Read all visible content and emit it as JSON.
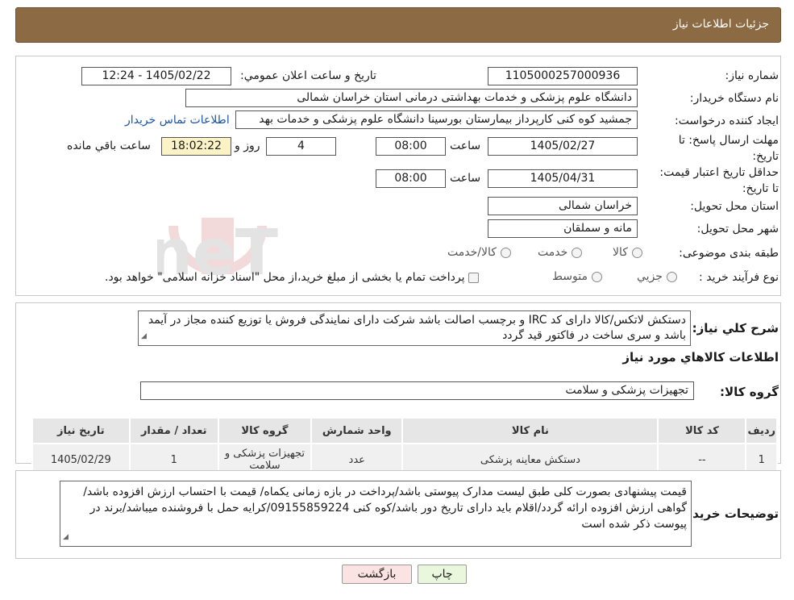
{
  "header": {
    "title": "جزئیات اطلاعات نیاز"
  },
  "form": {
    "need_number_label": "شماره نیاز:",
    "need_number": "1105000257000936",
    "announce_label": "تاریخ و ساعت اعلان عمومي:",
    "announce_value": "1405/02/22 - 12:24",
    "buyer_org_label": "نام دستگاه خريدار:",
    "buyer_org": "دانشگاه علوم پزشکی و خدمات بهداشتی درمانی استان خراسان شمالی",
    "creator_label": "ايجاد کننده درخواست:",
    "creator": "جمشید کوه کنی کارپرداز بیمارستان بورسینا دانشگاه علوم پزشکی و خدمات بهد",
    "contact_link": "اطلاعات تماس خريدار",
    "deadline_label": "مهلت ارسال پاسخ: تا تاريخ:",
    "deadline_date": "1405/02/27",
    "time_label": "ساعت",
    "deadline_time": "08:00",
    "days_value": "4",
    "days_label": "روز و",
    "remaining_time": "18:02:22",
    "remaining_label": "ساعت باقي مانده",
    "validity_label": "حداقل تاريخ اعتبار قيمت: تا تاريخ:",
    "validity_date": "1405/04/31",
    "validity_time": "08:00",
    "province_label": "استان محل تحويل:",
    "province": "خراسان شمالی",
    "city_label": "شهر محل تحويل:",
    "city": "مانه و سملقان",
    "category_label": "طبقه بندی موضوعی:",
    "category_options": [
      "کالا",
      "خدمت",
      "کالا/خدمت"
    ],
    "process_label": "نوع فرآيند خريد :",
    "process_options": [
      "جزيي",
      "متوسط"
    ],
    "process_note": "پرداخت تمام يا بخشی از مبلغ خريد،از محل \"اسناد خزانه اسلامی\" خواهد بود."
  },
  "description": {
    "label": "شرح کلي نياز:",
    "text": "دستکش لاتکس/کالا دارای کد IRC و برچسب اصالت باشد شرکت دارای نمایندگی فروش یا توزیع کننده  مجاز در آیمد باشد و سری ساخت در فاکتور قید گردد"
  },
  "goods": {
    "section_title": "اطلاعات کالاهاي مورد نياز",
    "group_label": "گروه کالا:",
    "group_value": "تجهیزات پزشکی و سلامت",
    "columns": [
      "رديف",
      "کد کالا",
      "نام کالا",
      "واحد شمارش",
      "گروه کالا",
      "تعداد / مقدار",
      "تاريخ نياز"
    ],
    "rows": [
      [
        "1",
        "--",
        "دستکش معاینه پزشکی",
        "عدد",
        "تجهیزات پزشکی و سلامت",
        "1",
        "1405/02/29"
      ]
    ]
  },
  "buyer_notes": {
    "label": "توضيحات خريدار:",
    "text": "قیمت پیشنهادی بصورت کلی طبق لیست مدارک پیوستی باشد/پرداخت در بازه زمانی یکماه/ قیمت با احتساب ارزش افزوده باشد/گواهی ارزش افزوده ارائه گردد/اقلام باید دارای تاریخ دور باشد/کوه کنی 09155859224/کرایه حمل با فروشنده میباشد/برند در پیوست ذکر شده است"
  },
  "buttons": {
    "print": "چاپ",
    "back": "بازگشت"
  },
  "colors": {
    "header": "#8c6a43",
    "print_button": "#e9f7dc",
    "back_button": "#fbe3e3",
    "remaining_box": "#fbf3c5"
  },
  "watermark": {
    "text": "AriaTender.neT"
  }
}
